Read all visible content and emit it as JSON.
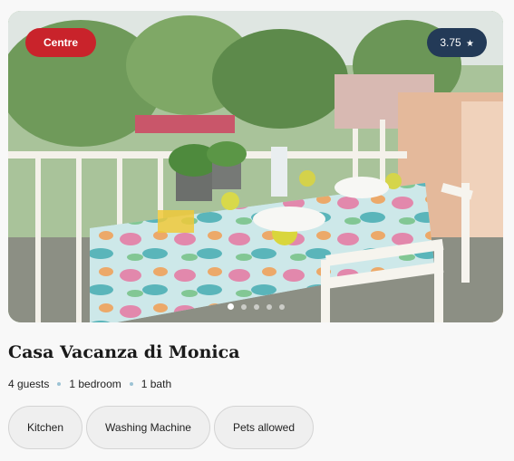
{
  "listing": {
    "badge": "Centre",
    "rating": "3.75",
    "rating_star": "★",
    "title": "Casa Vacanza di Monica",
    "guests": "4 guests",
    "bedrooms": "1 bedroom",
    "baths": "1 bath",
    "amenities": [
      "Kitchen",
      "Washing Machine",
      "Pets allowed"
    ],
    "carousel": {
      "total": 5,
      "active": 1
    }
  },
  "colors": {
    "badge": "#c9232b",
    "rating_bg": "#233a57",
    "separator_dot": "#9cc3d4"
  }
}
